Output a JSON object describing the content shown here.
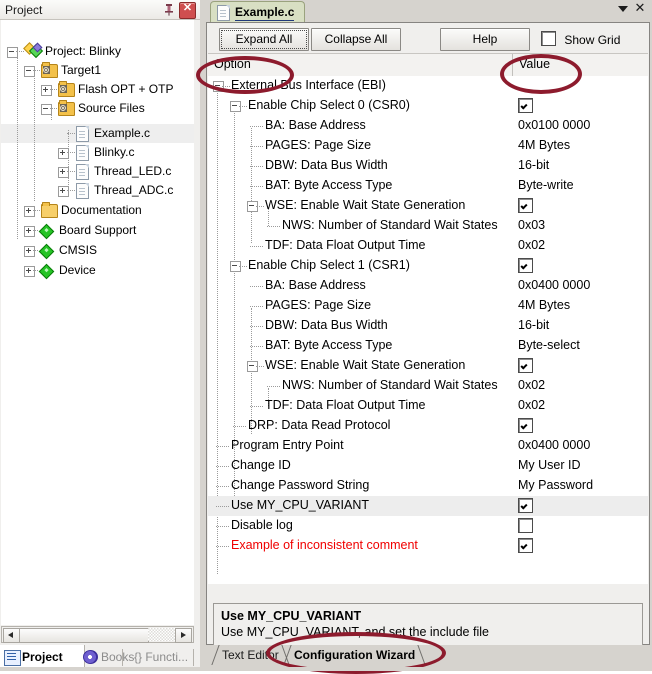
{
  "left_panel": {
    "title": "Project",
    "pin_icon": "pin-icon",
    "close_icon": "close-icon",
    "tree": [
      {
        "label": "Project: Blinky",
        "depth": 0,
        "expander": "minus",
        "icon": "project-icon"
      },
      {
        "label": "Target1",
        "depth": 1,
        "expander": "minus",
        "icon": "folder-target-icon"
      },
      {
        "label": "Flash OPT + OTP",
        "depth": 2,
        "expander": "plus",
        "icon": "folder-target-icon"
      },
      {
        "label": "Source Files",
        "depth": 2,
        "expander": "minus",
        "icon": "folder-target-icon"
      },
      {
        "label": "Example.c",
        "depth": 3,
        "expander": "none",
        "icon": "c-file-icon",
        "selected": true
      },
      {
        "label": "Blinky.c",
        "depth": 3,
        "expander": "plus",
        "icon": "c-file-icon"
      },
      {
        "label": "Thread_LED.c",
        "depth": 3,
        "expander": "plus",
        "icon": "c-file-icon"
      },
      {
        "label": "Thread_ADC.c",
        "depth": 3,
        "expander": "plus",
        "icon": "c-file-icon"
      },
      {
        "label": "Documentation",
        "depth": 2,
        "expander": "plus",
        "icon": "folder-icon"
      },
      {
        "label": "Board Support",
        "depth": 2,
        "expander": "plus",
        "icon": "component-icon"
      },
      {
        "label": "CMSIS",
        "depth": 2,
        "expander": "plus",
        "icon": "component-icon"
      },
      {
        "label": "Device",
        "depth": 2,
        "expander": "plus",
        "icon": "component-icon"
      }
    ],
    "tabs": [
      {
        "label": "Project",
        "active": true,
        "icon": "project-tab-icon"
      },
      {
        "label": "Books",
        "active": false,
        "icon": "books-tab-icon"
      },
      {
        "label": "{} Functi...",
        "active": false,
        "icon": "functions-tab-icon"
      }
    ],
    "hscrollbar": {
      "left_arrow": "scroll-left-icon",
      "right_arrow": "scroll-right-icon"
    }
  },
  "editor": {
    "tab": {
      "label": "Example.c",
      "icon": "c-file-icon"
    },
    "tab_menu_icon": "chevron-down-icon",
    "tab_close_icon": "close-icon",
    "toolbar": {
      "expand_all": "Expand All",
      "collapse_all": "Collapse All",
      "help": "Help",
      "show_grid": "Show Grid",
      "show_grid_checked": false
    },
    "columns": {
      "option": "Option",
      "value": "Value"
    },
    "rows": [
      {
        "option": "External Bus Interface (EBI)",
        "depth": 0,
        "expander": "minus",
        "value": "",
        "value_type": "text"
      },
      {
        "option": "Enable Chip Select 0 (CSR0)",
        "depth": 1,
        "expander": "minus",
        "value": "checked",
        "value_type": "checkbox"
      },
      {
        "option": "BA: Base Address",
        "depth": 2,
        "expander": "none",
        "value": "0x0100 0000",
        "value_type": "text"
      },
      {
        "option": "PAGES: Page Size",
        "depth": 2,
        "expander": "none",
        "value": "4M Bytes",
        "value_type": "text"
      },
      {
        "option": "DBW: Data Bus Width",
        "depth": 2,
        "expander": "none",
        "value": "16-bit",
        "value_type": "text"
      },
      {
        "option": "BAT: Byte Access Type",
        "depth": 2,
        "expander": "none",
        "value": "Byte-write",
        "value_type": "text"
      },
      {
        "option": "WSE: Enable Wait State Generation",
        "depth": 2,
        "expander": "minus",
        "value": "checked",
        "value_type": "checkbox"
      },
      {
        "option": "NWS: Number of Standard Wait States",
        "depth": 3,
        "expander": "none",
        "value": "0x03",
        "value_type": "text"
      },
      {
        "option": "TDF: Data Float Output Time",
        "depth": 2,
        "expander": "none",
        "value": "0x02",
        "value_type": "text"
      },
      {
        "option": "Enable Chip Select 1 (CSR1)",
        "depth": 1,
        "expander": "minus",
        "value": "checked",
        "value_type": "checkbox"
      },
      {
        "option": "BA: Base Address",
        "depth": 2,
        "expander": "none",
        "value": "0x0400 0000",
        "value_type": "text"
      },
      {
        "option": "PAGES: Page Size",
        "depth": 2,
        "expander": "none",
        "value": "4M Bytes",
        "value_type": "text"
      },
      {
        "option": "DBW: Data Bus Width",
        "depth": 2,
        "expander": "none",
        "value": "16-bit",
        "value_type": "text"
      },
      {
        "option": "BAT: Byte Access Type",
        "depth": 2,
        "expander": "none",
        "value": "Byte-select",
        "value_type": "text"
      },
      {
        "option": "WSE: Enable Wait State Generation",
        "depth": 2,
        "expander": "minus",
        "value": "checked",
        "value_type": "checkbox"
      },
      {
        "option": "NWS: Number of Standard Wait States",
        "depth": 3,
        "expander": "none",
        "value": "0x02",
        "value_type": "text"
      },
      {
        "option": "TDF: Data Float Output Time",
        "depth": 2,
        "expander": "none",
        "value": "0x02",
        "value_type": "text"
      },
      {
        "option": "DRP: Data Read Protocol",
        "depth": 2,
        "expander": "none",
        "value": "checked",
        "value_type": "checkbox"
      },
      {
        "option": "Program Entry Point",
        "depth": 1,
        "expander": "none",
        "value": "0x0400 0000",
        "value_type": "text"
      },
      {
        "option": "Change ID",
        "depth": 1,
        "expander": "none",
        "value": "My User ID",
        "value_type": "text"
      },
      {
        "option": "Change Password String",
        "depth": 1,
        "expander": "none",
        "value": "My Password",
        "value_type": "text"
      },
      {
        "option": "Use MY_CPU_VARIANT",
        "depth": 1,
        "expander": "none",
        "value": "checked",
        "value_type": "checkbox",
        "selected": true
      },
      {
        "option": "Disable log",
        "depth": 1,
        "expander": "none",
        "value": "unchecked",
        "value_type": "checkbox"
      },
      {
        "option": "Example of inconsistent comment",
        "depth": 1,
        "expander": "none",
        "value": "checked",
        "value_type": "checkbox",
        "error": true
      }
    ],
    "description": {
      "title": "Use MY_CPU_VARIANT",
      "text": "Use MY_CPU_VARIANT, and set the include file"
    },
    "bottom_tabs": [
      {
        "label": "Text Editor",
        "active": false
      },
      {
        "label": "Configuration Wizard",
        "active": true
      }
    ]
  },
  "annotations": {
    "ellipse_color": "#8d1b2d",
    "marks": [
      {
        "target": "option-column-header"
      },
      {
        "target": "value-column-header"
      },
      {
        "target": "configuration-wizard-tab"
      }
    ]
  }
}
